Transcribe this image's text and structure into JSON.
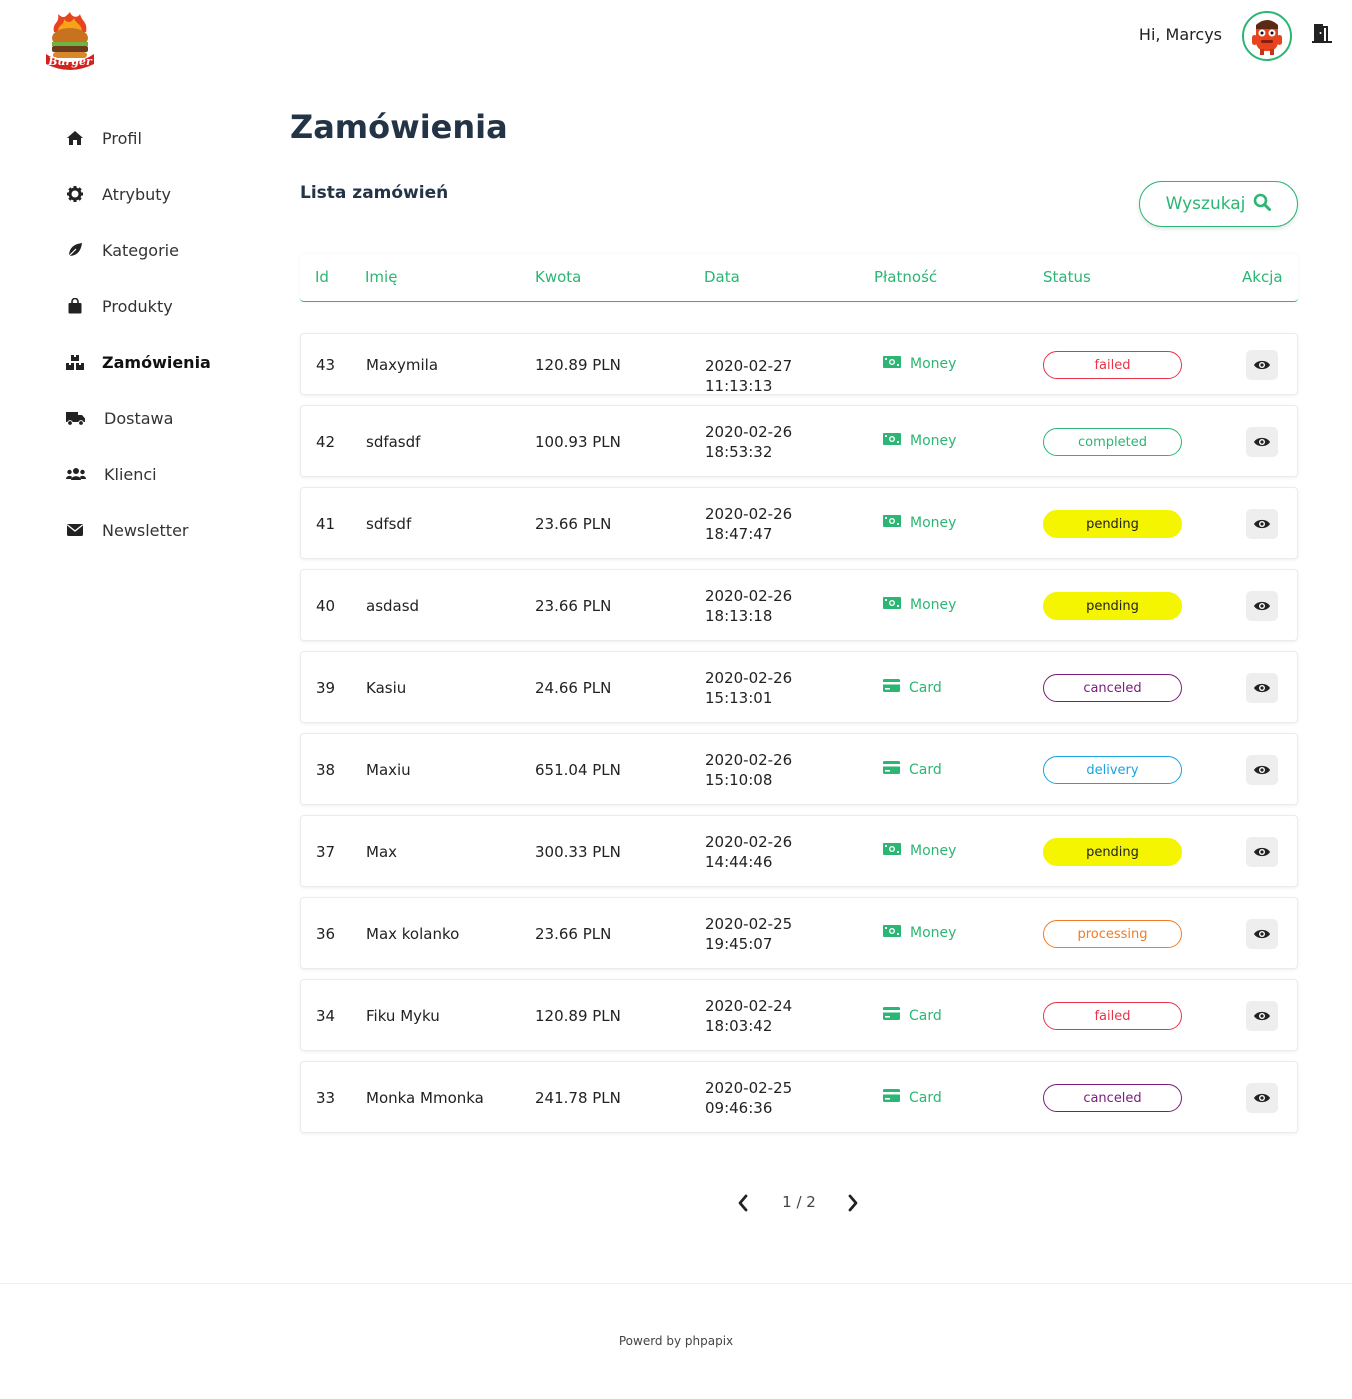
{
  "header": {
    "greeting": "Hi, Marcys",
    "logo_text": "Burger"
  },
  "sidebar": {
    "items": [
      {
        "label": "Profil",
        "icon": "home-icon",
        "active": false
      },
      {
        "label": "Atrybuty",
        "icon": "gear-icon",
        "active": false
      },
      {
        "label": "Kategorie",
        "icon": "leaf-icon",
        "active": false
      },
      {
        "label": "Produkty",
        "icon": "shopping-bag-icon",
        "active": false
      },
      {
        "label": "Zamówienia",
        "icon": "boxes-icon",
        "active": true
      },
      {
        "label": "Dostawa",
        "icon": "truck-icon",
        "active": false
      },
      {
        "label": "Klienci",
        "icon": "users-icon",
        "active": false
      },
      {
        "label": "Newsletter",
        "icon": "envelope-icon",
        "active": false
      }
    ]
  },
  "main": {
    "title": "Zamówienia",
    "subtitle": "Lista zamówień",
    "search_label": "Wyszukaj",
    "columns": [
      "Id",
      "Imię",
      "Kwota",
      "Data",
      "Płatność",
      "Status",
      "Akcja"
    ],
    "orders": [
      {
        "id": "43",
        "name": "Maxymila",
        "amount": "120.89 PLN",
        "date": "2020-02-27 11:13:13",
        "payment": "Money",
        "status": "failed"
      },
      {
        "id": "42",
        "name": "sdfasdf",
        "amount": "100.93 PLN",
        "date": "2020-02-26 18:53:32",
        "payment": "Money",
        "status": "completed"
      },
      {
        "id": "41",
        "name": "sdfsdf",
        "amount": "23.66 PLN",
        "date": "2020-02-26 18:47:47",
        "payment": "Money",
        "status": "pending"
      },
      {
        "id": "40",
        "name": "asdasd",
        "amount": "23.66 PLN",
        "date": "2020-02-26 18:13:18",
        "payment": "Money",
        "status": "pending"
      },
      {
        "id": "39",
        "name": "Kasiu",
        "amount": "24.66 PLN",
        "date": "2020-02-26 15:13:01",
        "payment": "Card",
        "status": "canceled"
      },
      {
        "id": "38",
        "name": "Maxiu",
        "amount": "651.04 PLN",
        "date": "2020-02-26 15:10:08",
        "payment": "Card",
        "status": "delivery"
      },
      {
        "id": "37",
        "name": "Max",
        "amount": "300.33 PLN",
        "date": "2020-02-26 14:44:46",
        "payment": "Money",
        "status": "pending"
      },
      {
        "id": "36",
        "name": "Max kolanko",
        "amount": "23.66 PLN",
        "date": "2020-02-25 19:45:07",
        "payment": "Money",
        "status": "processing"
      },
      {
        "id": "34",
        "name": "Fiku Myku",
        "amount": "120.89 PLN",
        "date": "2020-02-24 18:03:42",
        "payment": "Card",
        "status": "failed"
      },
      {
        "id": "33",
        "name": "Monka Mmonka",
        "amount": "241.78 PLN",
        "date": "2020-02-25 09:46:36",
        "payment": "Card",
        "status": "canceled"
      }
    ],
    "status_colors": {
      "failed": {
        "border": "#e8334a",
        "bg": "#ffffff",
        "text": "#e8334a"
      },
      "completed": {
        "border": "#2bb673",
        "bg": "#ffffff",
        "text": "#2bb673"
      },
      "pending": {
        "border": "#f5f500",
        "bg": "#f5f500",
        "text": "#222222"
      },
      "canceled": {
        "border": "#7a1d7a",
        "bg": "#ffffff",
        "text": "#7a1d7a"
      },
      "delivery": {
        "border": "#1aa3e0",
        "bg": "#ffffff",
        "text": "#1aa3e0"
      },
      "processing": {
        "border": "#f07b28",
        "bg": "#ffffff",
        "text": "#f07b28"
      }
    },
    "accent_color": "#2bb673"
  },
  "pagination": {
    "text": "1 / 2"
  },
  "footer": {
    "text": "Powerd by phpapix"
  }
}
